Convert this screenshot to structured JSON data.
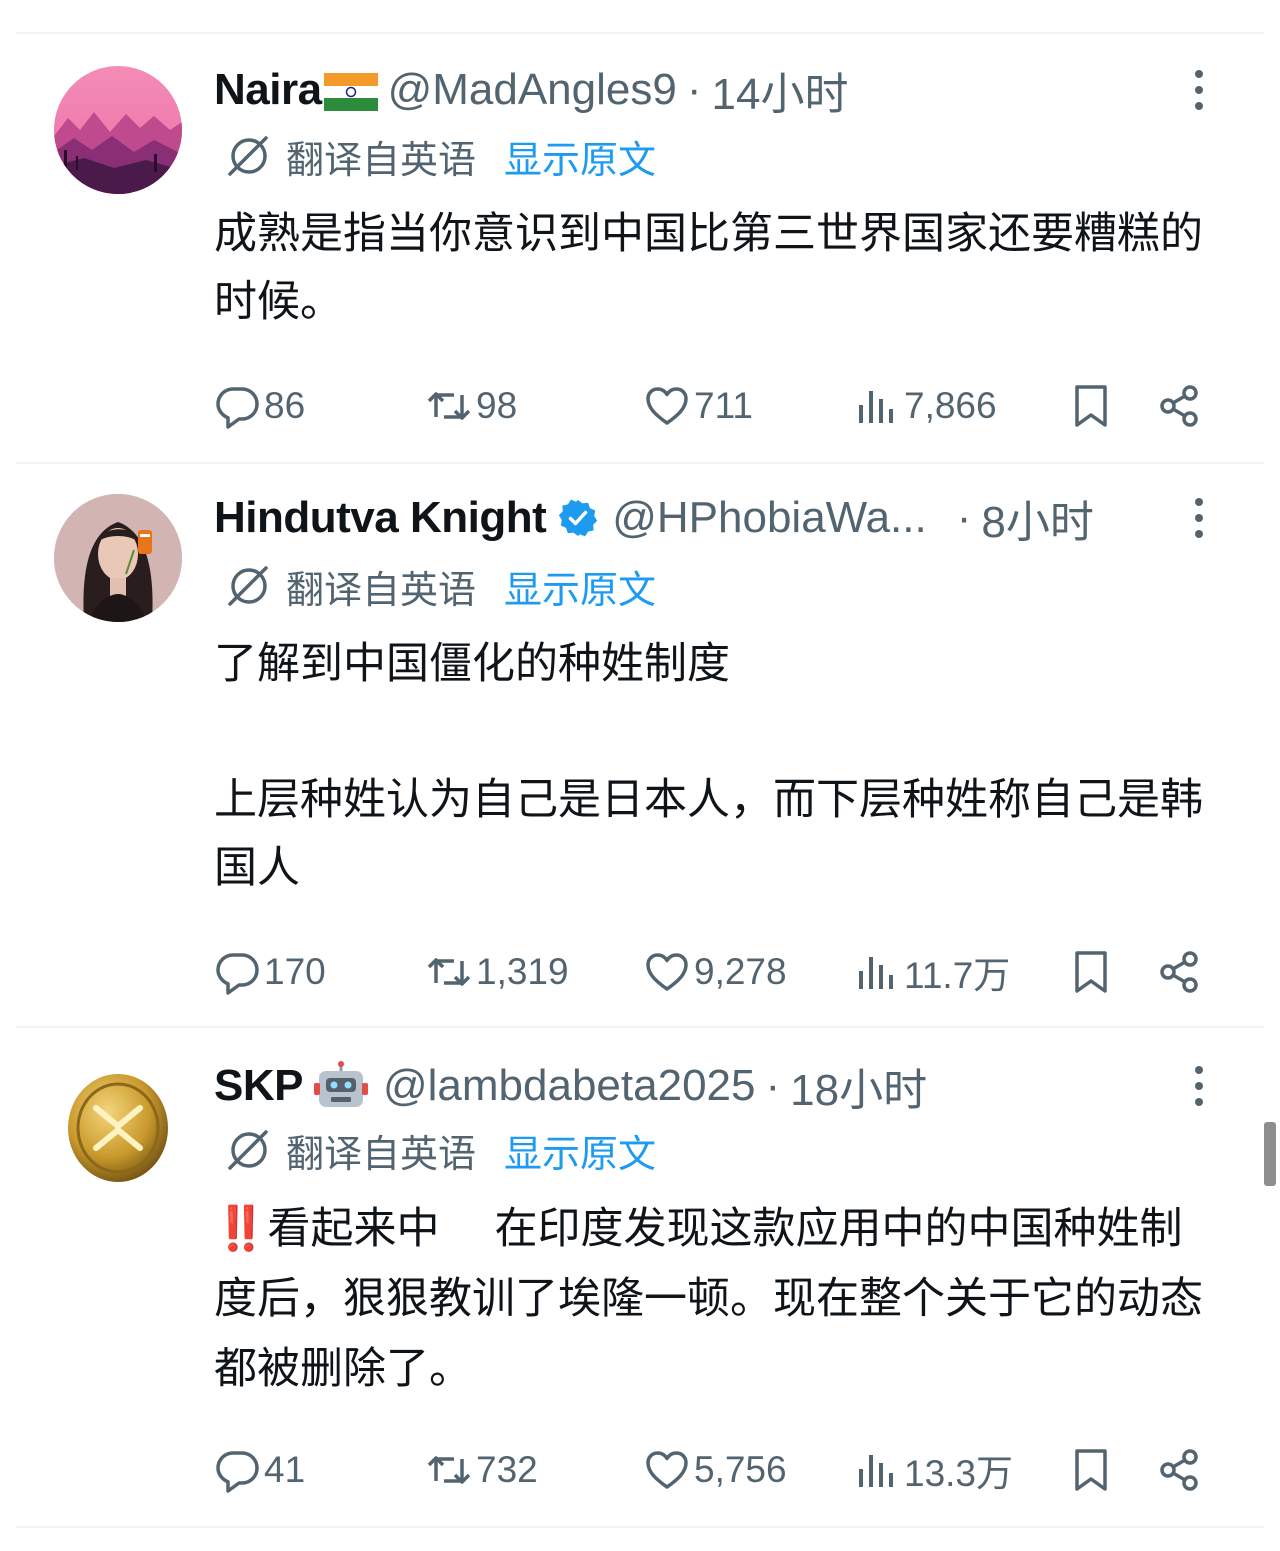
{
  "posts": [
    {
      "name": "Naira",
      "handle": "@MadAngles9",
      "time": "14小时",
      "translate_label": "翻译自英语",
      "show_original": "显示原文",
      "body": [
        "成熟是指当你意识到中国比第三世界国家还要糟糕的时候。"
      ],
      "replies": "86",
      "reposts": "98",
      "likes": "711",
      "views": "7,866"
    },
    {
      "name": "Hindutva Knight",
      "handle": "@HPhobiaWa...",
      "time": "8小时",
      "translate_label": "翻译自英语",
      "show_original": "显示原文",
      "body": [
        "了解到中国僵化的种姓制度",
        "上层种姓认为自己是日本人，而下层种姓称自己是韩国人"
      ],
      "replies": "170",
      "reposts": "1,319",
      "likes": "9,278",
      "views": "11.7万"
    },
    {
      "name": "SKP",
      "handle": "@lambdabeta2025",
      "time": "18小时",
      "translate_label": "翻译自英语",
      "show_original": "显示原文",
      "body": [
        "‼️看起来中　 在印度发现这款应用中的中国种姓制度后，狠狠教训了埃隆一顿。现在整个关于它的动态都被删除了。"
      ],
      "replies": "41",
      "reposts": "732",
      "likes": "5,756",
      "views": "13.3万"
    }
  ],
  "sep": "·",
  "icons": {
    "more": "more-vertical-icon",
    "translate": "translate-icon",
    "reply": "reply-icon",
    "repost": "repost-icon",
    "like": "heart-icon",
    "views": "views-icon",
    "bookmark": "bookmark-icon",
    "share": "share-icon",
    "verified": "verified-badge-icon",
    "flag": "india-flag-icon",
    "robot": "robot-emoji-icon"
  },
  "colors": {
    "text": "#0f1419",
    "secondary": "#536471",
    "link": "#1d9bf0",
    "divider": "#eff3f4"
  }
}
